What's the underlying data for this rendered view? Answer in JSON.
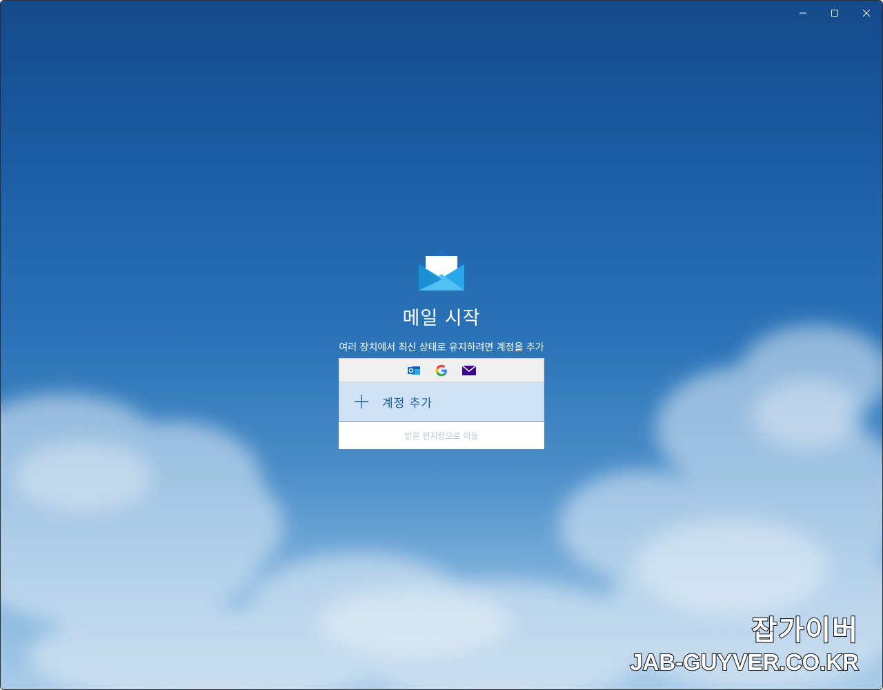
{
  "window": {
    "controls": {
      "minimize_icon": "minimize-icon",
      "maximize_icon": "maximize-icon",
      "close_icon": "close-icon"
    }
  },
  "welcome": {
    "logo_icon": "mail-envelope-icon",
    "heading": "메일 시작",
    "subtitle": "여러 장치에서 최신 상태로 유지하려면 계정을 추가"
  },
  "account_card": {
    "provider_icons": [
      "outlook-icon",
      "google-icon",
      "yahoo-mail-icon"
    ],
    "add_account_label": "계정 추가",
    "go_to_inbox_label": "받은 편지함으로 이동"
  },
  "watermark": {
    "line1": "잡가이버",
    "line2": "JAB-GUYVER.CO.KR"
  },
  "colors": {
    "accent": "#1d5f9e",
    "add_account_bg": "#cfe2f5",
    "providers_bg": "#efefef",
    "sky_top": "#154a8b",
    "sky_bottom": "#a9cbe7"
  }
}
